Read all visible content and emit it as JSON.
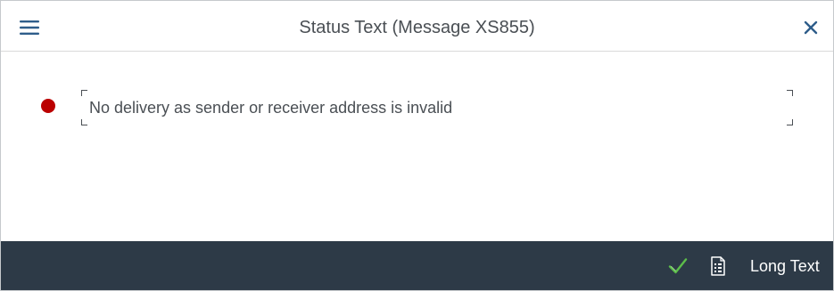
{
  "dialog": {
    "title": "Status Text (Message XS855)",
    "menu_icon": "hamburger-menu-icon",
    "close_icon": "close-icon"
  },
  "message": {
    "status_color": "#bb0000",
    "status_icon": "error-dot-icon",
    "text": "No delivery as sender or receiver address is invalid"
  },
  "toolbar": {
    "confirm_icon": "checkmark-icon",
    "confirm_color": "#5cbd4a",
    "document_icon": "document-details-icon",
    "long_text_label": "Long Text"
  },
  "colors": {
    "toolbar_background": "#2d3a47",
    "header_icon": "#1f4e79"
  }
}
